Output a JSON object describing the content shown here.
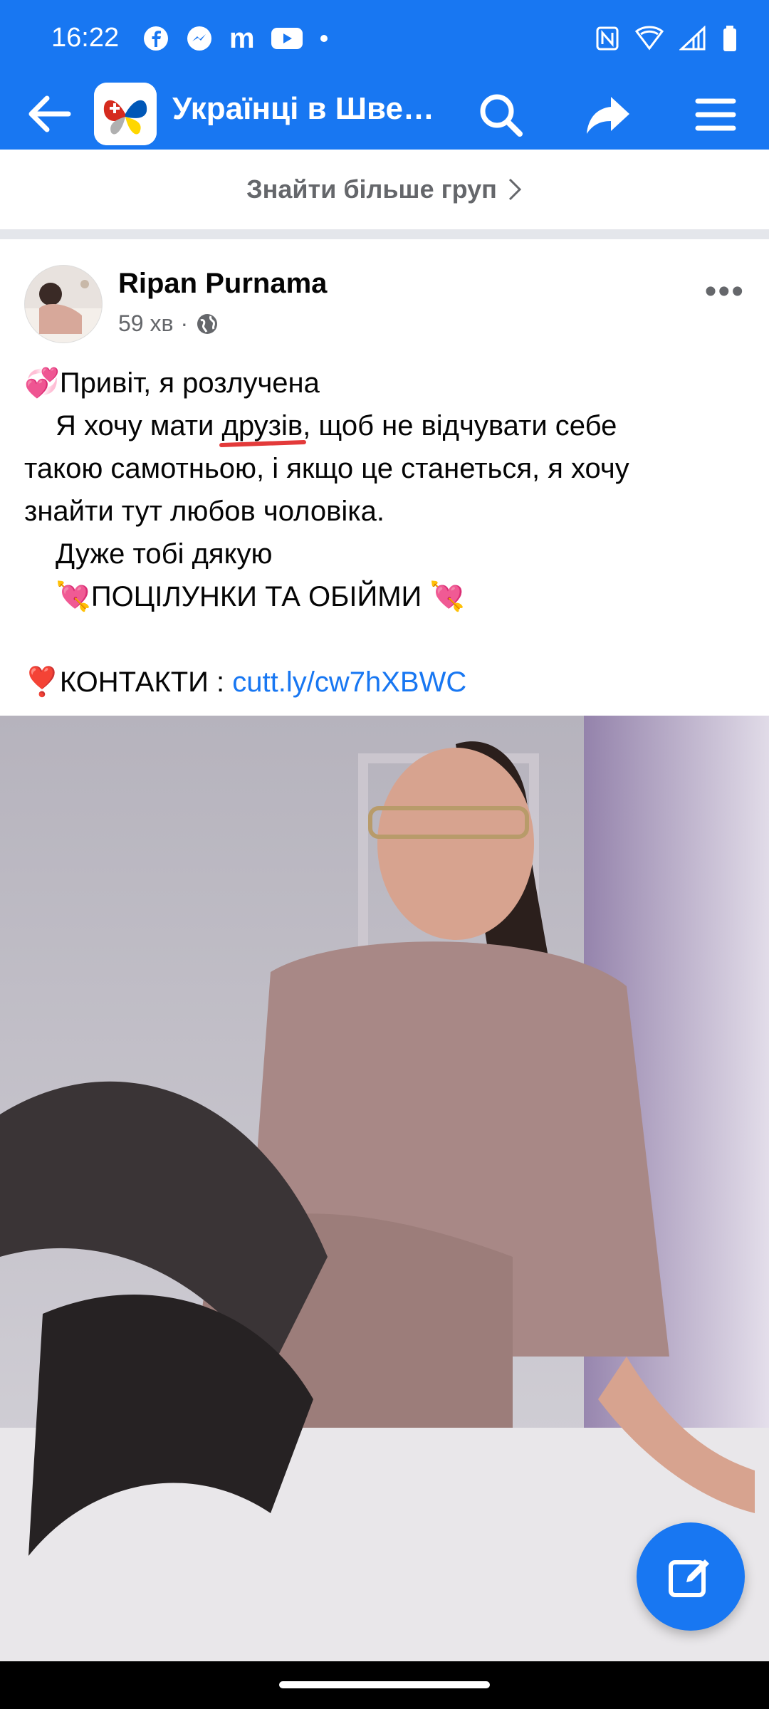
{
  "status_bar": {
    "time": "16:22",
    "notification_icons": [
      "facebook-icon",
      "messenger-icon",
      "m-icon",
      "youtube-icon",
      "dot-icon"
    ],
    "right_icons": [
      "nfc-icon",
      "wifi-icon",
      "signal-icon",
      "battery-icon"
    ]
  },
  "app_bar": {
    "title": "Українці в Шве…",
    "actions": [
      "search-icon",
      "share-icon",
      "menu-icon"
    ]
  },
  "find_more": {
    "label": "Знайти більше груп"
  },
  "post": {
    "author": "Ripan Purnama",
    "time": "59 хв",
    "separator": "·",
    "privacy_icon": "globe-icon",
    "more_label": "•••",
    "lines": {
      "l1": "Привіт, я розлучена",
      "l2a": "Я хочу мати ",
      "l2u": "друзів",
      "l2b": ", щоб не відчувати себе",
      "l3": "такою самотньою, і якщо це станеться, я хочу",
      "l4": "знайти тут любов чоловіка.",
      "l5": "Дуже тобі дякую",
      "l6": "ПОЦІЛУНКИ ТА ОБІЙМИ",
      "l7": "КОНТАКТИ : ",
      "link": "cutt.ly/cw7hXBWC"
    },
    "emoji": {
      "hearts": "💞",
      "cupid": "💘",
      "heart": "❣️"
    }
  },
  "fab": {
    "icon": "compose-icon"
  },
  "colors": {
    "brand": "#1877f2",
    "muted": "#65676b",
    "underline": "#e33a3a"
  }
}
